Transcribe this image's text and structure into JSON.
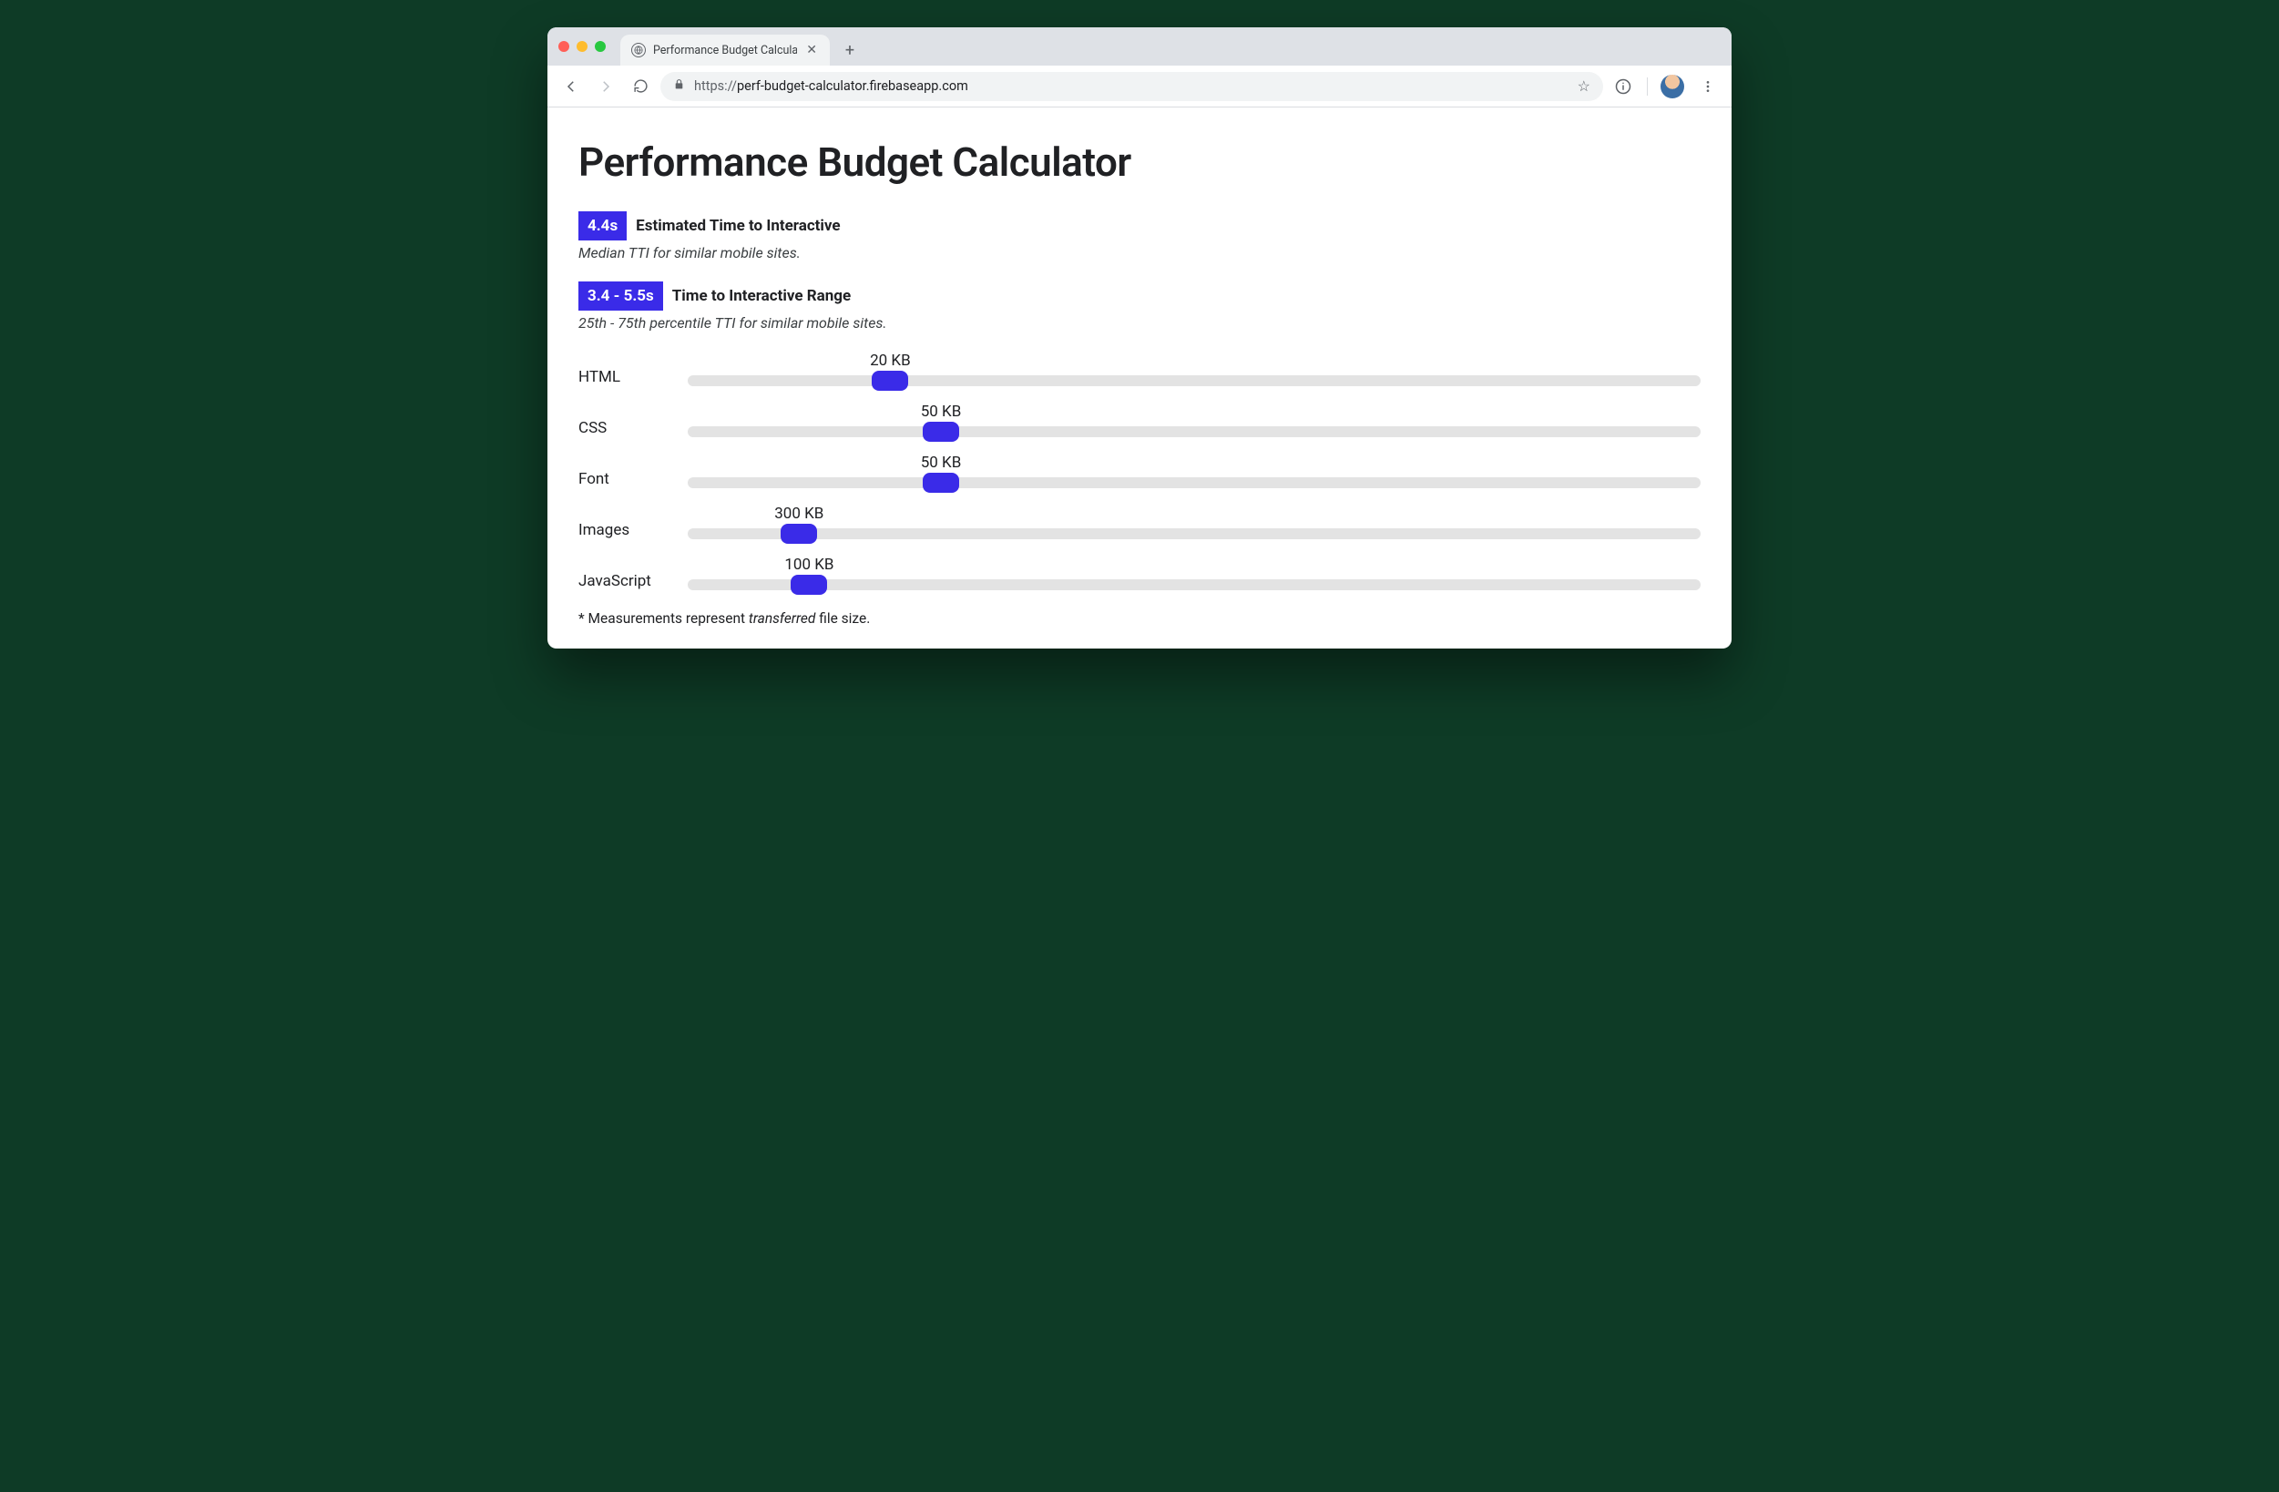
{
  "browser": {
    "tab_title": "Performance Budget Calculato",
    "url_scheme": "https://",
    "url_rest": "perf-budget-calculator.firebaseapp.com"
  },
  "page": {
    "title": "Performance Budget Calculator",
    "tti": {
      "badge": "4.4s",
      "label": "Estimated Time to Interactive",
      "sub": "Median TTI for similar mobile sites."
    },
    "tti_range": {
      "badge": "3.4 - 5.5s",
      "label": "Time to Interactive Range",
      "sub": "25th - 75th percentile TTI for similar mobile sites."
    },
    "sliders": [
      {
        "name": "HTML",
        "value_label": "20 KB",
        "pos_pct": 20
      },
      {
        "name": "CSS",
        "value_label": "50 KB",
        "pos_pct": 25
      },
      {
        "name": "Font",
        "value_label": "50 KB",
        "pos_pct": 25
      },
      {
        "name": "Images",
        "value_label": "300 KB",
        "pos_pct": 11
      },
      {
        "name": "JavaScript",
        "value_label": "100 KB",
        "pos_pct": 12
      }
    ],
    "footnote_pre": "* Measurements represent ",
    "footnote_em": "transferred",
    "footnote_post": " file size."
  }
}
